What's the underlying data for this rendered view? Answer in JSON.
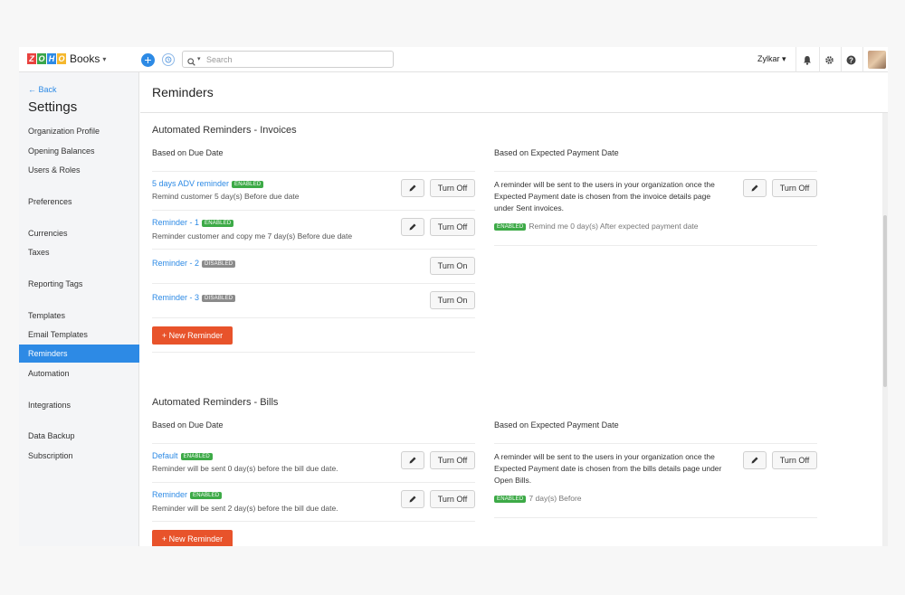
{
  "topbar": {
    "logo_letters": [
      "Z",
      "O",
      "H",
      "O"
    ],
    "logo_colors": [
      "#e8423f",
      "#3aa64c",
      "#2d8ae5",
      "#f5b82e"
    ],
    "product": "Books",
    "search_placeholder": "Search",
    "org_name": "Zylkar",
    "icons": [
      "plus-icon",
      "history-icon",
      "search-icon",
      "bell-icon",
      "gear-icon",
      "help-icon"
    ]
  },
  "sidebar": {
    "back_label": "← Back",
    "title": "Settings",
    "items": [
      "Organization Profile",
      "Opening Balances",
      "Users & Roles",
      "Preferences",
      "Currencies",
      "Taxes",
      "Reporting Tags",
      "Templates",
      "Email Templates",
      "Reminders",
      "Automation",
      "Integrations",
      "Data Backup",
      "Subscription"
    ],
    "active_item": "Reminders"
  },
  "main": {
    "page_title": "Reminders",
    "invoices": {
      "title": "Automated Reminders - Invoices",
      "due_date_head": "Based on Due Date",
      "epd_head": "Based on Expected Payment Date",
      "reminders": [
        {
          "name": "5 days ADV reminder",
          "status": "ENABLED",
          "desc": "Remind customer 5 day(s) Before due date",
          "action": "Turn Off"
        },
        {
          "name": "Reminder - 1",
          "status": "ENABLED",
          "desc": "Reminder customer and copy me 7 day(s) Before due date",
          "action": "Turn Off"
        },
        {
          "name": "Reminder - 2",
          "status": "DISABLED",
          "desc": "",
          "action": "Turn On"
        },
        {
          "name": "Reminder - 3",
          "status": "DISABLED",
          "desc": "",
          "action": "Turn On"
        }
      ],
      "new_button": "+ New Reminder",
      "epd": {
        "text": "A reminder will be sent to the users in your organization once the Expected Payment date is chosen from the invoice details page under Sent invoices.",
        "status": "ENABLED",
        "status_text": "Remind me 0 day(s) After expected payment date",
        "action": "Turn Off"
      }
    },
    "bills": {
      "title": "Automated Reminders - Bills",
      "due_date_head": "Based on Due Date",
      "epd_head": "Based on Expected Payment Date",
      "reminders": [
        {
          "name": "Default",
          "status": "ENABLED",
          "desc": "Reminder will be sent 0 day(s) before the bill due date.",
          "action": "Turn Off"
        },
        {
          "name": "Reminder",
          "status": "ENABLED",
          "desc": "Reminder will be sent 2 day(s) before the bill due date.",
          "action": "Turn Off"
        }
      ],
      "new_button": "+ New Reminder",
      "epd": {
        "text": "A reminder will be sent to the users in your organization once the Expected Payment date is chosen from the bills details page under Open Bills.",
        "status": "ENABLED",
        "status_text": "7 day(s) Before",
        "action": "Turn Off"
      }
    }
  }
}
